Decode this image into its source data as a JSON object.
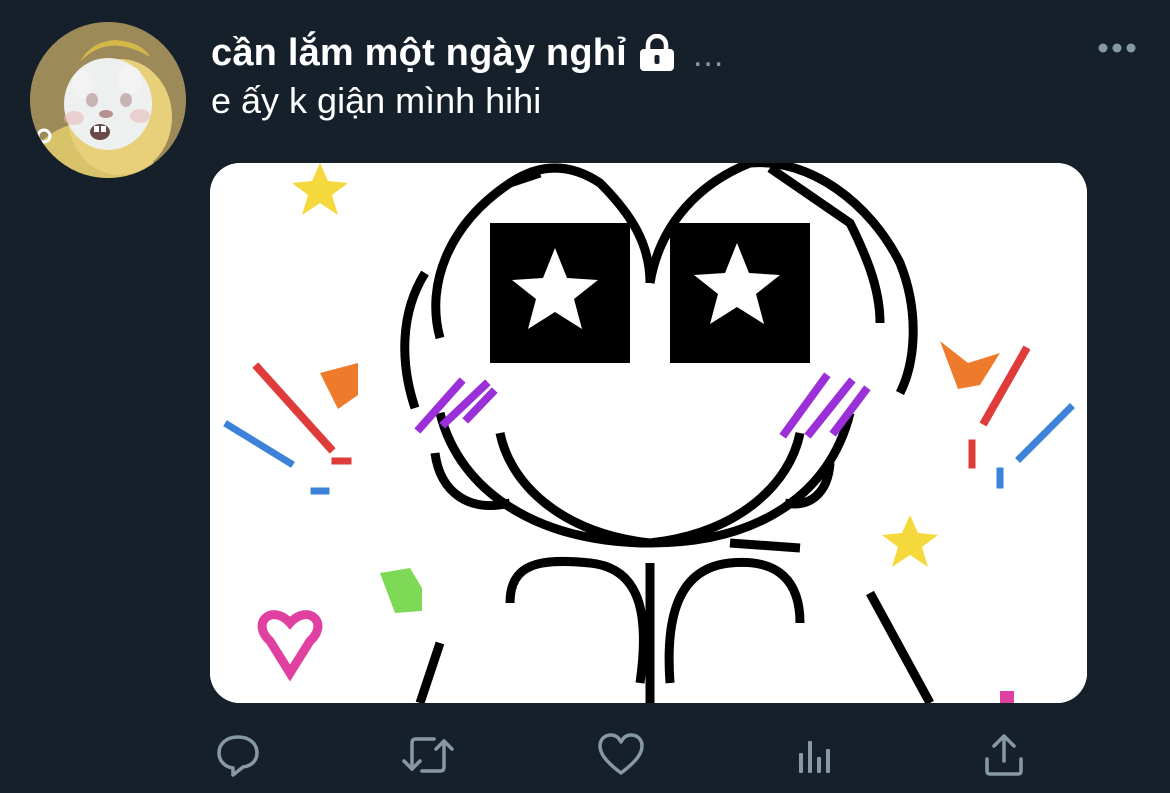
{
  "tweet": {
    "display_name": "cần lắm một ngày nghỉ",
    "protected_icon": "lock-icon",
    "handle_truncated": "...",
    "text": "e ấy k giận mình hihi",
    "more_icon": "more-horizontal-icon",
    "avatar_icon": "avatar-image",
    "media_icon": "pixel-art-image"
  },
  "actions": [
    {
      "name": "reply",
      "icon": "reply-icon"
    },
    {
      "name": "retweet",
      "icon": "retweet-icon"
    },
    {
      "name": "like",
      "icon": "heart-icon"
    },
    {
      "name": "analytics",
      "icon": "analytics-icon"
    },
    {
      "name": "share",
      "icon": "share-icon"
    }
  ],
  "colors": {
    "background": "#15202b",
    "text_primary": "#ffffff",
    "text_secondary": "#8899a6",
    "icon": "#8899a6"
  }
}
